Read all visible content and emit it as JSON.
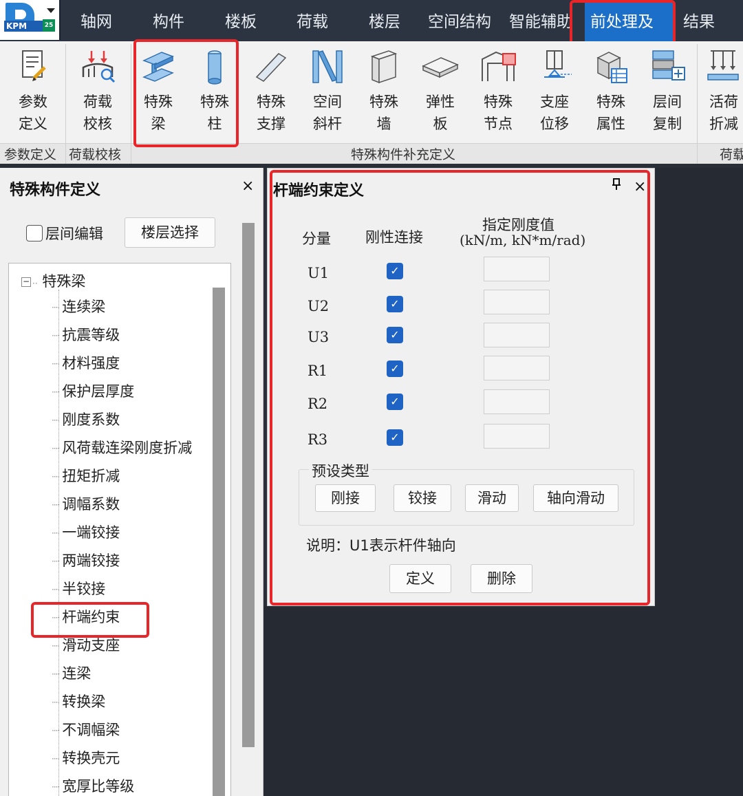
{
  "menu": {
    "items": [
      "轴网",
      "构件",
      "楼板",
      "荷载",
      "楼层",
      "空间结构",
      "智能辅助",
      "前处理及",
      "结果"
    ],
    "active": "前处理及"
  },
  "logo": {
    "text": "KPM",
    "badge": "25"
  },
  "ribbon": {
    "tools": [
      {
        "line1": "参数",
        "line2": "定义",
        "icon": "document-pencil-icon"
      },
      {
        "line1": "荷载",
        "line2": "校核",
        "icon": "load-check-icon"
      },
      {
        "line1": "特殊",
        "line2": "梁",
        "icon": "steel-beam-icon"
      },
      {
        "line1": "特殊",
        "line2": "柱",
        "icon": "column-icon"
      },
      {
        "line1": "特殊",
        "line2": "支撑",
        "icon": "brace-icon"
      },
      {
        "line1": "空间",
        "line2": "斜杆",
        "icon": "diagonal-member-icon"
      },
      {
        "line1": "特殊",
        "line2": "墙",
        "icon": "wall-icon"
      },
      {
        "line1": "弹性",
        "line2": "板",
        "icon": "plate-icon"
      },
      {
        "line1": "特殊",
        "line2": "节点",
        "icon": "node-icon"
      },
      {
        "line1": "支座",
        "line2": "位移",
        "icon": "support-displacement-icon"
      },
      {
        "line1": "特殊",
        "line2": "属性",
        "icon": "property-icon"
      },
      {
        "line1": "层间",
        "line2": "复制",
        "icon": "copy-layer-icon"
      },
      {
        "line1": "活荷",
        "line2": "折减",
        "icon": "live-load-reduction-icon"
      }
    ],
    "groups": [
      "参数定义",
      "荷载校核",
      "特殊构件补充定义",
      "荷载"
    ]
  },
  "left_panel": {
    "title": "特殊构件定义",
    "close": "×",
    "layer_edit_label": "层间编辑",
    "layer_select_button": "楼层选择",
    "tree_root": "特殊梁",
    "tree_toggle": "−",
    "tree_items": [
      "连续梁",
      "抗震等级",
      "材料强度",
      "保护层厚度",
      "刚度系数",
      "风荷载连梁刚度折减",
      "扭矩折减",
      "调幅系数",
      "一端铰接",
      "两端铰接",
      "半铰接",
      "杆端约束",
      "滑动支座",
      "连梁",
      "转换梁",
      "不调幅梁",
      "转换壳元",
      "宽厚比等级"
    ],
    "selected_item": "杆端约束"
  },
  "dialog": {
    "title": "杆端约束定义",
    "pin": "ㅍ",
    "close": "×",
    "col_component": "分量",
    "col_rigid": "刚性连接",
    "col_stiffness_line1": "指定刚度值",
    "col_stiffness_line2": "(kN/m, kN*m/rad)",
    "rows": [
      {
        "label": "U1",
        "rigid": true,
        "stiffness": ""
      },
      {
        "label": "U2",
        "rigid": true,
        "stiffness": ""
      },
      {
        "label": "U3",
        "rigid": true,
        "stiffness": ""
      },
      {
        "label": "R1",
        "rigid": true,
        "stiffness": ""
      },
      {
        "label": "R2",
        "rigid": true,
        "stiffness": ""
      },
      {
        "label": "R3",
        "rigid": true,
        "stiffness": ""
      }
    ],
    "preset_legend": "预设类型",
    "preset_buttons": [
      "刚接",
      "铰接",
      "滑动",
      "轴向滑动"
    ],
    "note": "说明：U1表示杆件轴向",
    "define_button": "定义",
    "delete_button": "删除"
  },
  "colors": {
    "menu_bg": "#2b3440",
    "active_menu": "#1b6fc8",
    "highlight": "#e8262a",
    "checkbox_blue": "#1f63c4",
    "icon_blue": "#4a90d9"
  }
}
